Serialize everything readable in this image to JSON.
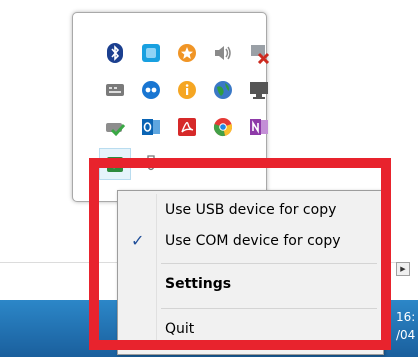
{
  "tray": {
    "icons": [
      {
        "name": "bluetooth-icon",
        "color": "#1b3f8f"
      },
      {
        "name": "sticky-app-icon",
        "color": "#18a0e0"
      },
      {
        "name": "star-badge-icon",
        "color": "#f09526"
      },
      {
        "name": "speaker-icon",
        "color": "#8a8a8a"
      },
      {
        "name": "network-blocked-icon",
        "color": "#cc2a1f"
      },
      {
        "name": "keyboard-device-icon",
        "color": "#7a7a7a"
      },
      {
        "name": "flickr-dots-icon",
        "color": "#1976d2"
      },
      {
        "name": "orange-info-icon",
        "color": "#f5a623"
      },
      {
        "name": "globe-icon",
        "color": "#2e9e3f"
      },
      {
        "name": "monitor-icon",
        "color": "#555555"
      },
      {
        "name": "drive-check-icon",
        "color": "#3aa845"
      },
      {
        "name": "outlook-icon",
        "color": "#0a64b4"
      },
      {
        "name": "pdf-icon",
        "color": "#d62929"
      },
      {
        "name": "chrome-icon",
        "color": "#e53935"
      },
      {
        "name": "onenote-icon",
        "color": "#8e3aa8"
      },
      {
        "name": "green-app-icon",
        "color": "#2e8b3e"
      },
      {
        "name": "usb-plug-icon",
        "color": "#777777"
      }
    ]
  },
  "context_menu": {
    "items": [
      {
        "label": "Use USB device for copy",
        "checked": false,
        "bold": false
      },
      {
        "label": "Use COM device for copy",
        "checked": true,
        "bold": false
      },
      {
        "label": "Settings",
        "checked": false,
        "bold": true
      },
      {
        "label": "Quit",
        "checked": false,
        "bold": false
      }
    ],
    "check_symbol": "✓"
  },
  "taskbar": {
    "clock_time": "16:",
    "clock_date": "/04"
  },
  "scroll_arrow": "▶",
  "colors": {
    "highlight": "#e8232d",
    "taskbar": "#1f6fb0",
    "menu_background": "#f1f1f1"
  }
}
